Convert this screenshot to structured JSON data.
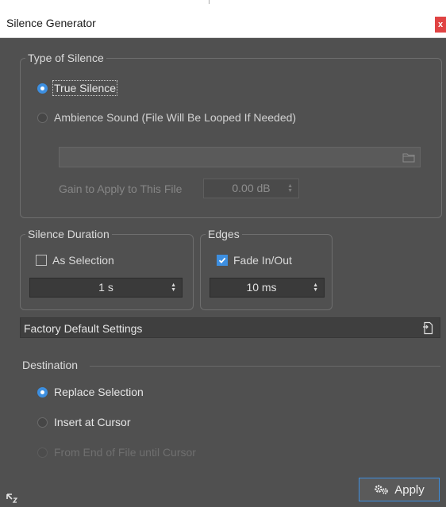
{
  "window": {
    "title": "Silence Generator",
    "close_label": "x"
  },
  "type_of_silence": {
    "legend": "Type of Silence",
    "true_silence": "True Silence",
    "ambience_sound": "Ambience Sound (File Will Be Looped If Needed)",
    "file_path": "",
    "gain_label": "Gain to Apply to This File",
    "gain_value": "0.00 dB",
    "selected": "true_silence"
  },
  "silence_duration": {
    "legend": "Silence Duration",
    "as_selection_label": "As Selection",
    "as_selection_checked": false,
    "duration_value": "1 s"
  },
  "edges": {
    "legend": "Edges",
    "fade_label": "Fade In/Out",
    "fade_checked": true,
    "fade_value": "10 ms"
  },
  "presets": {
    "label": "Factory Default Settings"
  },
  "destination": {
    "label": "Destination",
    "replace_selection": "Replace Selection",
    "insert_at_cursor": "Insert at Cursor",
    "from_end_until_cursor": "From End of File until Cursor",
    "selected": "replace_selection"
  },
  "footer": {
    "apply_label": "Apply"
  },
  "icons": {
    "radio": "radio-icon",
    "folder": "folder-icon",
    "spinner": "spinner-arrows-icon",
    "checkbox": "checkbox-icon",
    "preset": "preset-file-icon",
    "apply": "gears-icon",
    "resize": "resize-grip-icon"
  },
  "colors": {
    "background": "#505050",
    "accent": "#3d8fe0",
    "field": "#3a3a3a",
    "close": "#e04343"
  }
}
